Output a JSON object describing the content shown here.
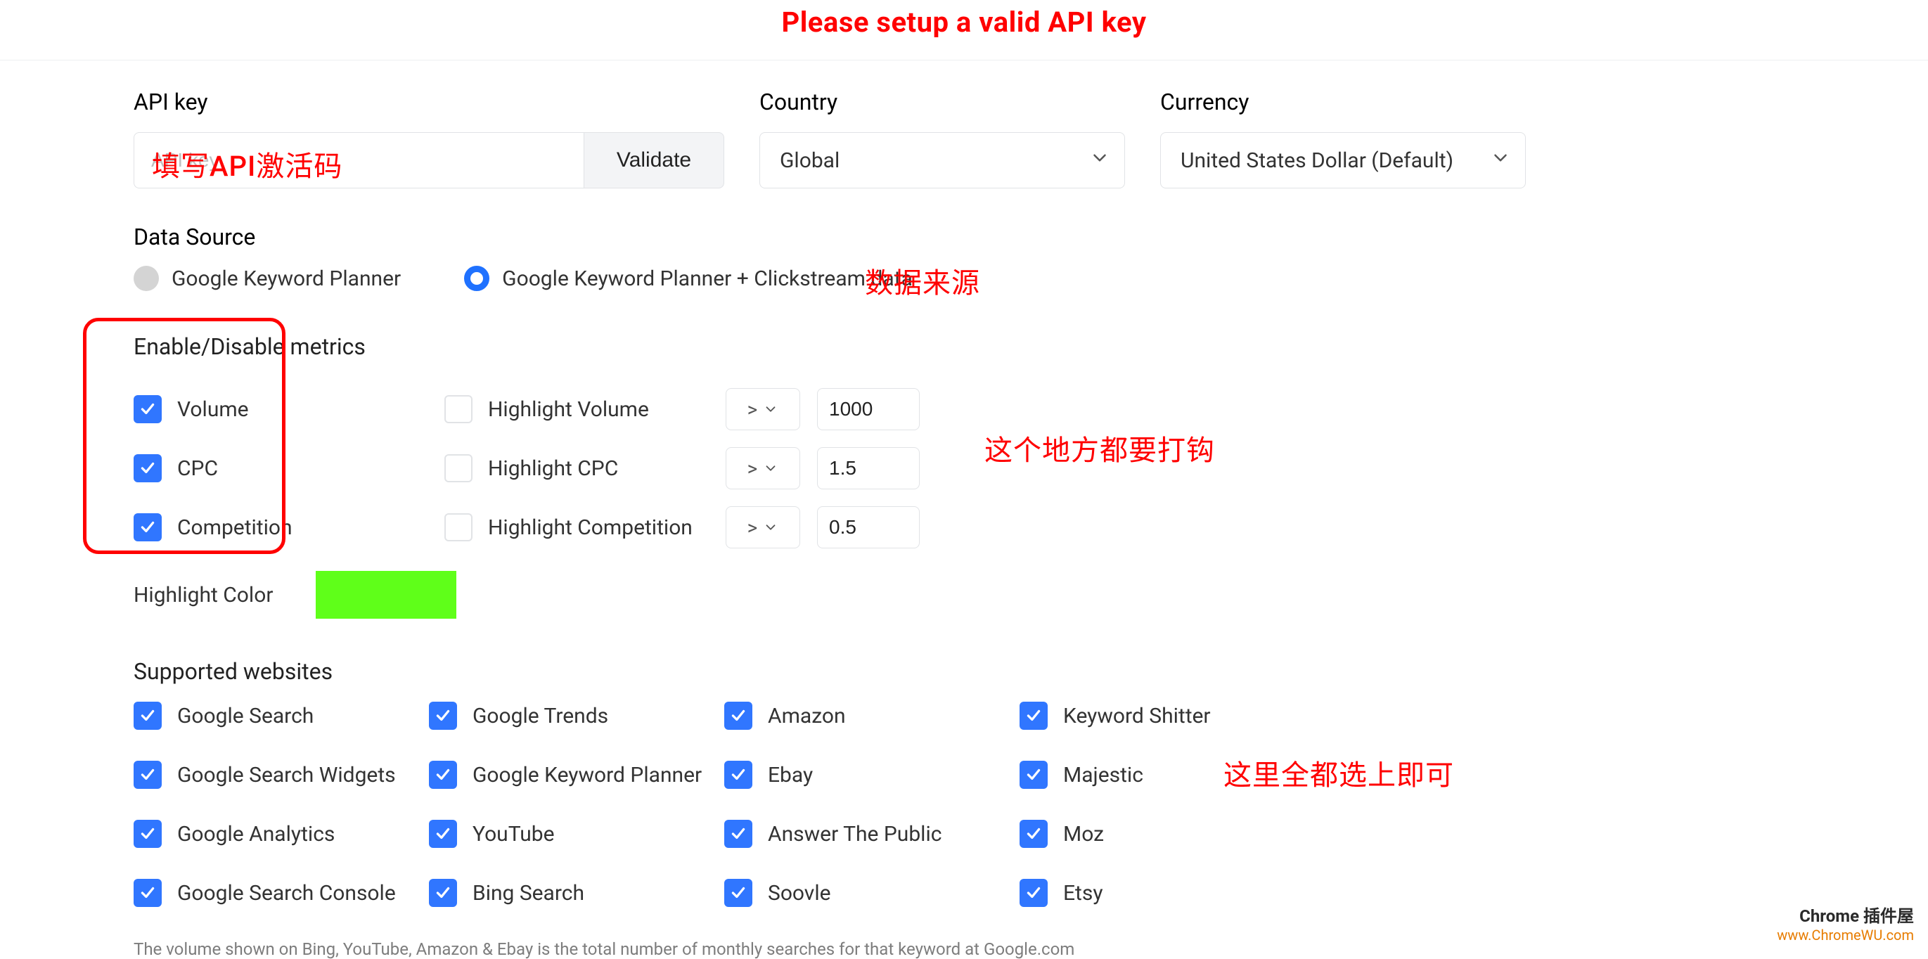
{
  "banner": "Please setup a valid API key",
  "api": {
    "label": "API key",
    "placeholder": "API key",
    "validate": "Validate"
  },
  "country": {
    "label": "Country",
    "value": "Global"
  },
  "currency": {
    "label": "Currency",
    "value": "United States Dollar (Default)"
  },
  "data_source": {
    "label": "Data Source",
    "opt1": "Google Keyword Planner",
    "opt2": "Google Keyword Planner + Clickstream data"
  },
  "metrics": {
    "heading": "Enable/Disable metrics",
    "rows": [
      {
        "name": "Volume",
        "hl": "Highlight Volume",
        "op": ">",
        "val": "1000"
      },
      {
        "name": "CPC",
        "hl": "Highlight CPC",
        "op": ">",
        "val": "1.5"
      },
      {
        "name": "Competition",
        "hl": "Highlight Competition",
        "op": ">",
        "val": "0.5"
      }
    ],
    "highlight_color_label": "Highlight Color",
    "highlight_color": "#5fff19"
  },
  "sites": {
    "heading": "Supported websites",
    "list": [
      "Google Search",
      "Google Trends",
      "Amazon",
      "Keyword Shitter",
      "Google Search Widgets",
      "Google Keyword Planner",
      "Ebay",
      "Majestic",
      "Google Analytics",
      "YouTube",
      "Answer The Public",
      "Moz",
      "Google Search Console",
      "Bing Search",
      "Soovle",
      "Etsy"
    ]
  },
  "footnote": "The volume shown on Bing, YouTube, Amazon & Ebay is the total number of monthly searches for that keyword at Google.com",
  "annotations": {
    "api": "填写API激活码",
    "ds": "数据来源",
    "ck": "这个地方都要打钩",
    "sites": "这里全都选上即可"
  },
  "watermark": {
    "line1": "Chrome 插件屋",
    "line2": "www.ChromeWU.com"
  }
}
